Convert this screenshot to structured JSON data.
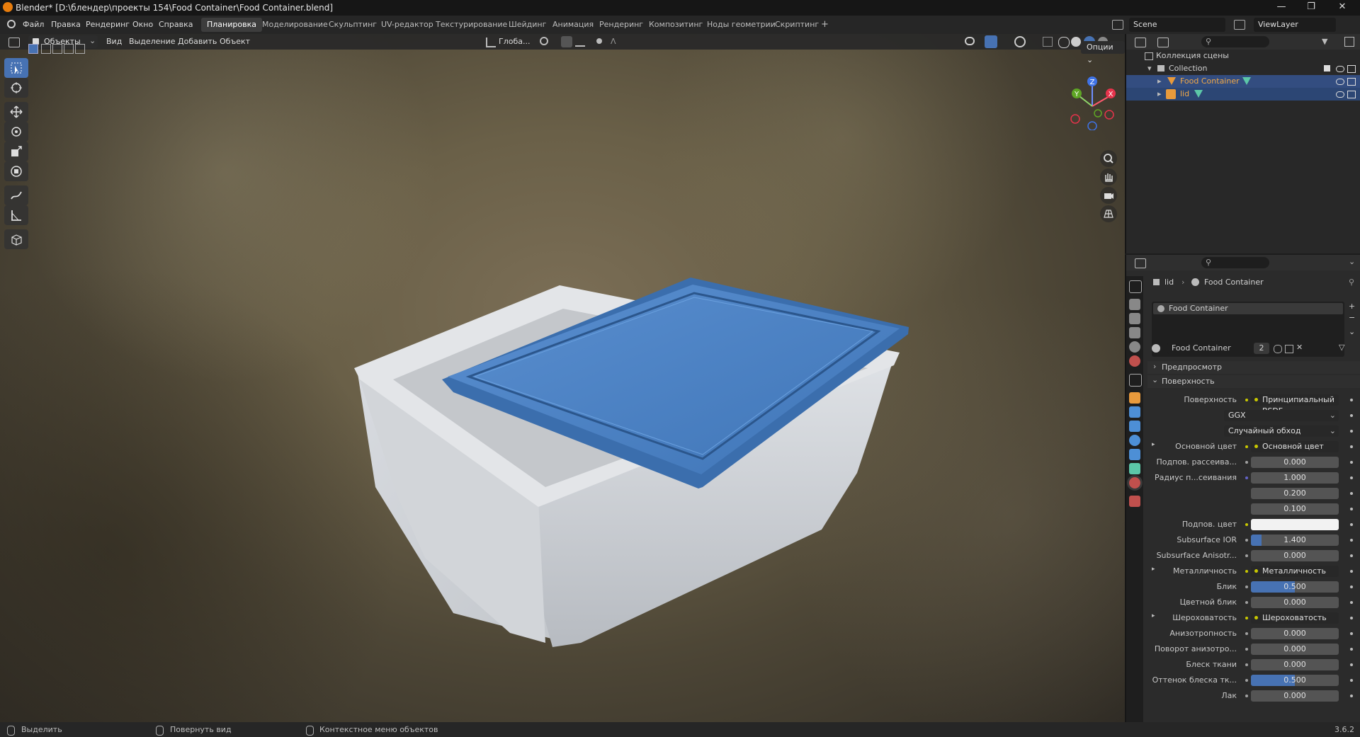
{
  "title_bar": {
    "title": "Blender* [D:\\блендер\\проекты 154\\Food Container\\Food Container.blend]"
  },
  "menu": {
    "items": [
      "Файл",
      "Правка",
      "Рендеринг",
      "Окно",
      "Справка"
    ]
  },
  "workspaces": [
    "Планировка",
    "Моделирование",
    "Скульптинг",
    "UV-редактор",
    "Текстурирование",
    "Шейдинг",
    "Анимация",
    "Рендеринг",
    "Композитинг",
    "Ноды геометрии",
    "Скриптинг"
  ],
  "active_workspace": "Планировка",
  "scene": {
    "name": "Scene",
    "view_layer": "ViewLayer"
  },
  "viewport_header": {
    "mode": "Объекты",
    "view": "Вид",
    "select": "Выделение",
    "add": "Добавить",
    "object": "Объект",
    "orientation": "Глоба...",
    "options": "Опции"
  },
  "gizmo_axes": {
    "x": "X",
    "y": "Y",
    "z": "Z"
  },
  "colors": {
    "lid": "#4a80c2",
    "container": "#cfd2d6",
    "accent": "#4772b3",
    "selected_row": "#334d80"
  },
  "outliner": {
    "root": "Коллекция сцены",
    "collection": "Collection",
    "objects": [
      {
        "name": "Food Container",
        "active": true
      },
      {
        "name": "lid",
        "active": false
      }
    ]
  },
  "properties": {
    "breadcrumb": {
      "object": "lid",
      "material": "Food Container"
    },
    "slot": "Food Container",
    "material_name": "Food Container",
    "users": "2",
    "panels": {
      "preview": "Предпросмотр",
      "surface": "Поверхность"
    },
    "rows": [
      {
        "label": "Поверхность",
        "value": "Принципиальный BSDF",
        "kind": "link",
        "dot": "#c8c800"
      },
      {
        "label": "",
        "value": "GGX",
        "kind": "select"
      },
      {
        "label": "",
        "value": "Случайный обход",
        "kind": "select"
      },
      {
        "label": "Основной цвет",
        "value": "Основной цвет",
        "kind": "link",
        "dot": "#c8c800",
        "expand": true
      },
      {
        "label": "Подпов. рассеива...",
        "value": "0.000",
        "kind": "num",
        "dot": "#a1a1a1"
      },
      {
        "label": "Радиус п...сеивания",
        "value": "1.000",
        "kind": "num",
        "dot": "#6363c7"
      },
      {
        "label": "",
        "value": "0.200",
        "kind": "num"
      },
      {
        "label": "",
        "value": "0.100",
        "kind": "num"
      },
      {
        "label": "Подпов. цвет",
        "value": "",
        "kind": "color",
        "dot": "#c8c800",
        "color": "#f2f2f2"
      },
      {
        "label": "Subsurface IOR",
        "value": "1.400",
        "kind": "bar",
        "dot": "#a1a1a1",
        "fill": 0.12
      },
      {
        "label": "Subsurface Anisotr...",
        "value": "0.000",
        "kind": "num",
        "dot": "#a1a1a1"
      },
      {
        "label": "Металличность",
        "value": "Металличность",
        "kind": "link",
        "dot": "#c8c800",
        "expand": true
      },
      {
        "label": "Блик",
        "value": "0.500",
        "kind": "bar",
        "dot": "#a1a1a1",
        "fill": 0.5
      },
      {
        "label": "Цветной блик",
        "value": "0.000",
        "kind": "num",
        "dot": "#a1a1a1"
      },
      {
        "label": "Шероховатость",
        "value": "Шероховатость",
        "kind": "link",
        "dot": "#c8c800",
        "expand": true
      },
      {
        "label": "Анизотропность",
        "value": "0.000",
        "kind": "num",
        "dot": "#a1a1a1"
      },
      {
        "label": "Поворот анизотро...",
        "value": "0.000",
        "kind": "num",
        "dot": "#a1a1a1"
      },
      {
        "label": "Блеск ткани",
        "value": "0.000",
        "kind": "num",
        "dot": "#a1a1a1"
      },
      {
        "label": "Оттенок блеска тк...",
        "value": "0.500",
        "kind": "bar",
        "dot": "#a1a1a1",
        "fill": 0.5
      },
      {
        "label": "Лак",
        "value": "0.000",
        "kind": "num",
        "dot": "#a1a1a1"
      }
    ]
  },
  "status_bar": {
    "select": "Выделить",
    "rotate": "Повернуть вид",
    "context": "Контекстное меню объектов",
    "version": "3.6.2"
  }
}
